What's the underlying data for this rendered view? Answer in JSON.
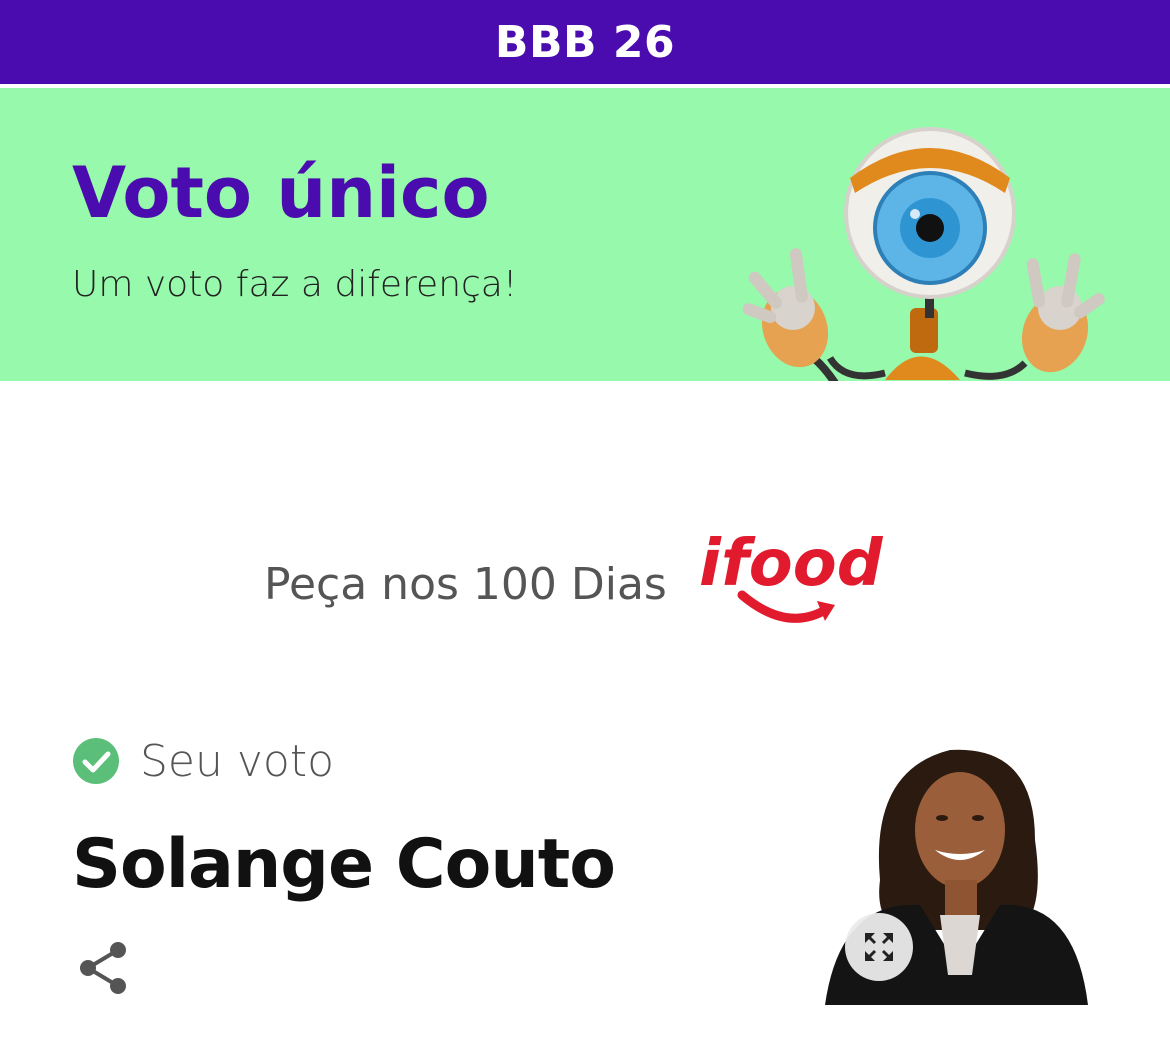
{
  "header": {
    "title": "BBB 26",
    "bg_color": "#4a0cae"
  },
  "banner": {
    "headline": "Voto único",
    "subhead": "Um voto faz a diferença!",
    "bg_color": "#96f9ab",
    "headline_color": "#4a0cae",
    "mascot_icon": "big-brother-eye-robot-mascot"
  },
  "sponsor": {
    "text": "Peça nos 100 Dias",
    "brand": "ifood",
    "brand_color": "#e11b2d"
  },
  "vote": {
    "label": "Seu voto",
    "status_icon": "check-circle-icon",
    "status_color": "#5bbf7a",
    "candidate_name": "Solange Couto",
    "share_icon": "share-icon",
    "expand_icon": "expand-icon"
  }
}
